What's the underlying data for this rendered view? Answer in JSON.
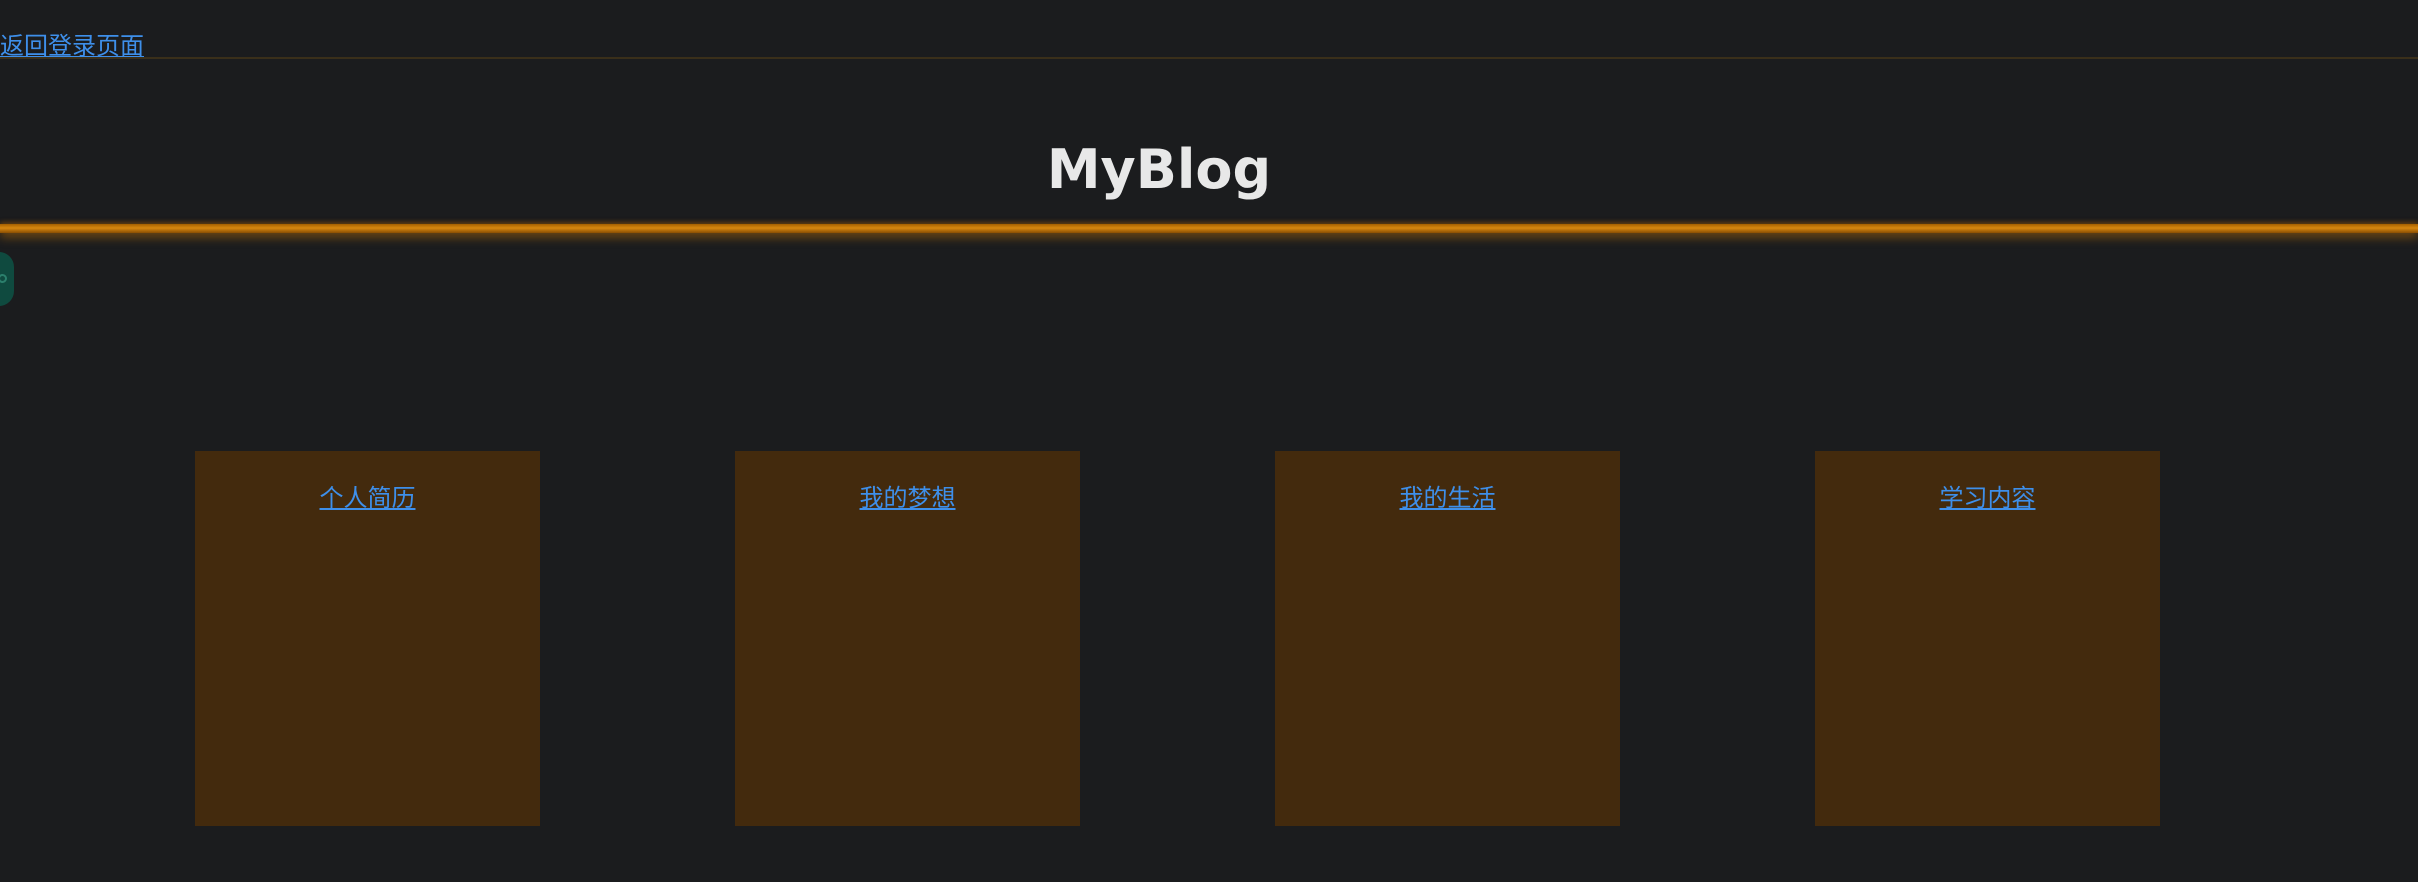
{
  "header": {
    "back_link": "返回登录页面",
    "site_title": "MyBlog"
  },
  "colors": {
    "background": "#1b1c1e",
    "accent_bar": "#d7870f",
    "card_bg": "#432a0d",
    "link": "#3e8fea",
    "title": "#e8e8e8"
  },
  "cards": [
    {
      "label": "个人简历"
    },
    {
      "label": "我的梦想"
    },
    {
      "label": "我的生活"
    },
    {
      "label": "学习内容"
    }
  ]
}
